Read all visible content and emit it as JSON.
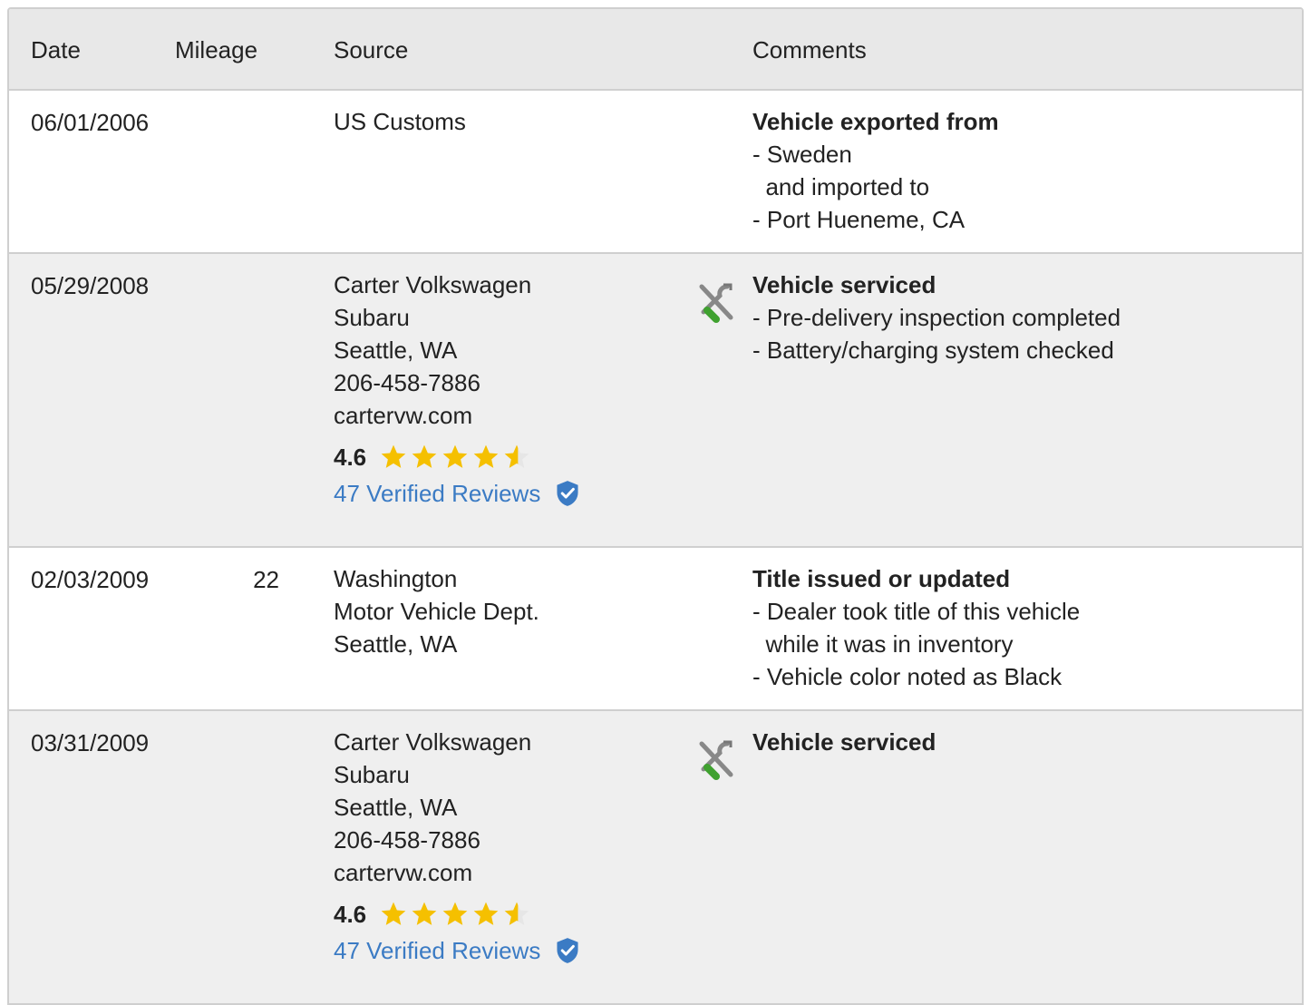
{
  "header": {
    "date": "Date",
    "mileage": "Mileage",
    "source": "Source",
    "comments": "Comments"
  },
  "rows": [
    {
      "date": "06/01/2006",
      "mileage": "",
      "source": [
        "US Customs"
      ],
      "comment_title": "Vehicle exported from",
      "comment_lines": [
        "- Sweden",
        "  and imported to",
        "- Port Hueneme, CA"
      ]
    },
    {
      "date": "05/29/2008",
      "mileage": "",
      "source": [
        "Carter Volkswagen",
        "Subaru",
        "Seattle, WA",
        "206-458-7886",
        "cartervw.com"
      ],
      "rating": "4.6",
      "reviews": "47 Verified Reviews",
      "icon": "service-tools-icon",
      "comment_title": "Vehicle serviced",
      "comment_lines": [
        "- Pre-delivery inspection completed",
        "- Battery/charging system checked"
      ]
    },
    {
      "date": "02/03/2009",
      "mileage": "22",
      "source": [
        "Washington",
        "Motor Vehicle Dept.",
        "Seattle, WA"
      ],
      "comment_title": "Title issued or updated",
      "comment_lines": [
        "- Dealer took title of this vehicle",
        "  while it was in inventory",
        "- Vehicle color noted as Black"
      ]
    },
    {
      "date": "03/31/2009",
      "mileage": "",
      "source": [
        "Carter Volkswagen",
        "Subaru",
        "Seattle, WA",
        "206-458-7886",
        "cartervw.com"
      ],
      "rating": "4.6",
      "reviews": "47 Verified Reviews",
      "icon": "service-tools-icon",
      "comment_title": "Vehicle serviced",
      "comment_lines": []
    }
  ],
  "colors": {
    "star": "#f5c000",
    "link": "#3b7bc4",
    "header_bg": "#e8e8e8",
    "row_gray": "#efefef"
  }
}
